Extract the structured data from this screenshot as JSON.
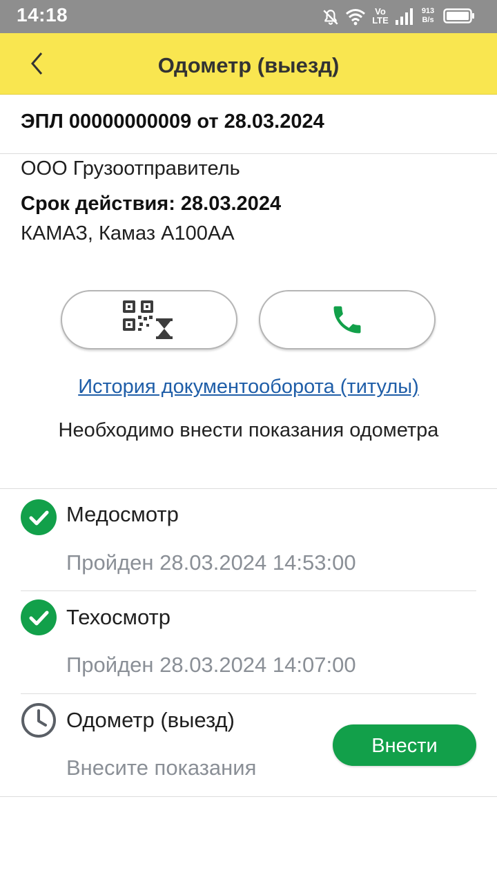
{
  "status_bar": {
    "time": "14:18",
    "network_top": "Vo",
    "network_bottom": "LTE",
    "speed_value": "913",
    "speed_unit": "B/s",
    "icons": [
      "mute-bell-icon",
      "wifi-icon",
      "signal-icon",
      "battery-icon"
    ]
  },
  "app_bar": {
    "title": "Одометр (выезд)",
    "back_icon": "chevron-left-icon",
    "background": "#f9e650"
  },
  "document": {
    "title": "ЭПЛ 00000000009 от 28.03.2024",
    "shipper": "ООО Грузоотправитель",
    "validity": "Срок действия: 28.03.2024",
    "vehicle": "КАМАЗ, Камаз А100АА"
  },
  "actions": {
    "qr_button_icon": "qr-hourglass-icon",
    "call_button_icon": "phone-icon",
    "history_link": "История документооборота (титулы)",
    "notice": "Необходимо внести показания одометра"
  },
  "checklist": [
    {
      "title": "Медосмотр",
      "subtitle": "Пройден 28.03.2024 14:53:00",
      "status": "done"
    },
    {
      "title": "Техосмотр",
      "subtitle": "Пройден 28.03.2024 14:07:00",
      "status": "done"
    },
    {
      "title": "Одометр (выезд)",
      "subtitle": "Внесите показания",
      "status": "pending",
      "button": "Внести"
    }
  ],
  "colors": {
    "accent_green": "#12a04a",
    "link_blue": "#1f5ea8",
    "muted_text": "#8a8f96"
  }
}
